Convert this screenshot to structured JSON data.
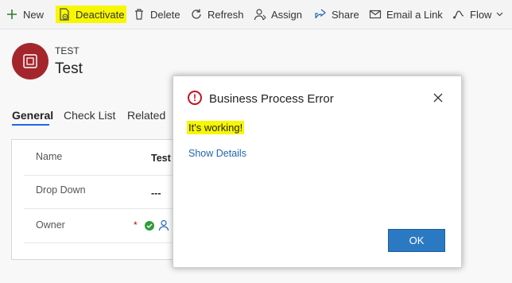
{
  "commandbar": {
    "new": "New",
    "deactivate": "Deactivate",
    "delete": "Delete",
    "refresh": "Refresh",
    "assign": "Assign",
    "share": "Share",
    "email_link": "Email a Link",
    "flow": "Flow"
  },
  "record": {
    "entity": "TEST",
    "name": "Test"
  },
  "tabs": [
    "General",
    "Check List",
    "Related"
  ],
  "form": {
    "fields": [
      {
        "label": "Name",
        "value": "Test"
      },
      {
        "label": "Drop Down",
        "value": "---"
      },
      {
        "label": "Owner",
        "value": ""
      }
    ],
    "required_marker": "*"
  },
  "dialog": {
    "title": "Business Process Error",
    "message": "It's working!",
    "details_link": "Show Details",
    "ok_label": "OK"
  },
  "colors": {
    "highlight": "#f6f700",
    "primary": "#2b79c2",
    "error": "#c50f1f",
    "avatar": "#a4262c"
  }
}
